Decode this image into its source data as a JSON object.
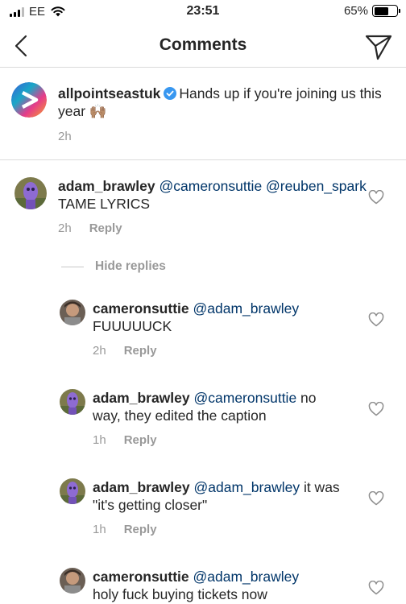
{
  "status_bar": {
    "carrier": "EE",
    "time": "23:51",
    "battery": "65%",
    "battery_level": 0.65
  },
  "header": {
    "title": "Comments"
  },
  "caption": {
    "username": "allpointseastuk",
    "text": "Hands up if you're joining us this year",
    "emoji": "🙌🏽",
    "time": "2h"
  },
  "comments": [
    {
      "username": "adam_brawley",
      "mentions": "@cameronsuttie @reuben_spark",
      "text": " TAME LYRICS",
      "time": "2h",
      "reply_label": "Reply"
    },
    {
      "username": "cameronsuttie",
      "mentions": "@adam_brawley",
      "text": " FUUUUUCK",
      "time": "2h",
      "reply_label": "Reply"
    },
    {
      "username": "adam_brawley",
      "mentions": "@cameronsuttie",
      "text": " no way, they edited the caption",
      "time": "1h",
      "reply_label": "Reply"
    },
    {
      "username": "adam_brawley",
      "mentions": "@adam_brawley",
      "text": " it was \"it's getting closer\"",
      "time": "1h",
      "reply_label": "Reply"
    },
    {
      "username": "cameronsuttie",
      "mentions": "@adam_brawley",
      "text": " holy fuck buying tickets now",
      "time": "",
      "reply_label": ""
    }
  ],
  "hide_replies_label": "Hide replies",
  "colors": {
    "mention": "#003569",
    "verified": "#3897f0",
    "muted": "#999999",
    "divider": "#dbdbdb"
  },
  "icons": {
    "back": "chevron-left-icon",
    "send": "paper-plane-icon",
    "like": "heart-outline-icon",
    "verified": "verified-badge-icon"
  }
}
